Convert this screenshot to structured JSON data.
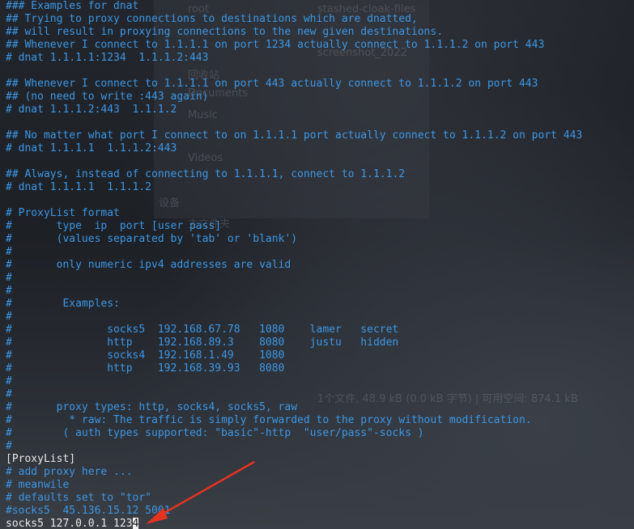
{
  "background_labels": [
    "root",
    "stashed-cloak-files",
    "screenshot_2022",
    "回收站",
    "Documents",
    "Music",
    "Videos",
    "设备",
    "主文件夹",
    "1个文件, 48.9 kB (0.0 kB 字节) | 可用空间: 874.1 kB"
  ],
  "lines": [
    {
      "text": "### Examples for dnat",
      "kind": "comment"
    },
    {
      "text": "## Trying to proxy connections to destinations which are dnatted,",
      "kind": "comment"
    },
    {
      "text": "## will result in proxying connections to the new given destinations.",
      "kind": "comment"
    },
    {
      "text": "## Whenever I connect to 1.1.1.1 on port 1234 actually connect to 1.1.1.2 on port 443",
      "kind": "comment"
    },
    {
      "text": "# dnat 1.1.1.1:1234  1.1.1.2:443",
      "kind": "comment"
    },
    {
      "text": "",
      "kind": "comment"
    },
    {
      "text": "## Whenever I connect to 1.1.1.1 on port 443 actually connect to 1.1.1.2 on port 443",
      "kind": "comment"
    },
    {
      "text": "## (no need to write :443 again)",
      "kind": "comment"
    },
    {
      "text": "# dnat 1.1.1.2:443  1.1.1.2",
      "kind": "comment"
    },
    {
      "text": "",
      "kind": "comment"
    },
    {
      "text": "## No matter what port I connect to on 1.1.1.1 port actually connect to 1.1.1.2 on port 443",
      "kind": "comment"
    },
    {
      "text": "# dnat 1.1.1.1  1.1.1.2:443",
      "kind": "comment"
    },
    {
      "text": "",
      "kind": "comment"
    },
    {
      "text": "## Always, instead of connecting to 1.1.1.1, connect to 1.1.1.2",
      "kind": "comment"
    },
    {
      "text": "# dnat 1.1.1.1  1.1.1.2",
      "kind": "comment"
    },
    {
      "text": "",
      "kind": "comment"
    },
    {
      "text": "# ProxyList format",
      "kind": "comment"
    },
    {
      "text": "#       type  ip  port [user pass]",
      "kind": "comment"
    },
    {
      "text": "#       (values separated by 'tab' or 'blank')",
      "kind": "comment"
    },
    {
      "text": "#",
      "kind": "comment"
    },
    {
      "text": "#       only numeric ipv4 addresses are valid",
      "kind": "comment"
    },
    {
      "text": "#",
      "kind": "comment"
    },
    {
      "text": "#",
      "kind": "comment"
    },
    {
      "text": "#        Examples:",
      "kind": "comment"
    },
    {
      "text": "#",
      "kind": "comment"
    },
    {
      "text": "#               socks5  192.168.67.78   1080    lamer   secret",
      "kind": "comment"
    },
    {
      "text": "#               http    192.168.89.3    8080    justu   hidden",
      "kind": "comment"
    },
    {
      "text": "#               socks4  192.168.1.49    1080",
      "kind": "comment"
    },
    {
      "text": "#               http    192.168.39.93   8080",
      "kind": "comment"
    },
    {
      "text": "#",
      "kind": "comment"
    },
    {
      "text": "#",
      "kind": "comment"
    },
    {
      "text": "#       proxy types: http, socks4, socks5, raw",
      "kind": "comment"
    },
    {
      "text": "#         * raw: The traffic is simply forwarded to the proxy without modification.",
      "kind": "comment"
    },
    {
      "text": "#        ( auth types supported: \"basic\"-http  \"user/pass\"-socks )",
      "kind": "comment"
    },
    {
      "text": "#",
      "kind": "comment"
    },
    {
      "text": "[ProxyList]",
      "kind": "plain"
    },
    {
      "text": "# add proxy here ...",
      "kind": "comment"
    },
    {
      "text": "# meanwile",
      "kind": "comment"
    },
    {
      "text": "# defaults set to \"tor\"",
      "kind": "comment"
    },
    {
      "text": "#socks5  45.136.15.12 5001",
      "kind": "comment"
    }
  ],
  "last_line": {
    "before_cursor": "socks5 127.0.0.1 123",
    "cursor_char": "4"
  },
  "colors": {
    "comment": "#3c97e6",
    "plain": "#e8e8e8",
    "arrow": "#e53322",
    "background": "#1c1f24"
  }
}
